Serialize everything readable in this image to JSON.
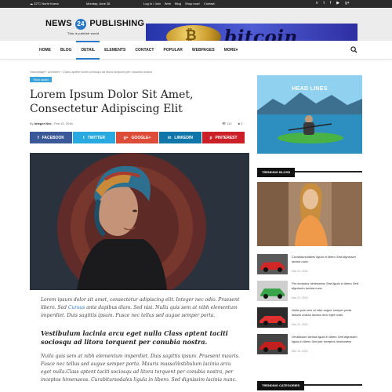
{
  "topbar": {
    "location": "22°C North Korea",
    "date": "Monday, June 28",
    "links": [
      "Log In / Join",
      "Web",
      "Blog",
      "Shop now!",
      "Contact"
    ],
    "social_icons": [
      "vimeo-icon",
      "twitter-icon",
      "facebook-icon",
      "youtube-icon",
      "google-plus-icon"
    ]
  },
  "logo": {
    "left": "NEWS",
    "number": "24",
    "right": "PUBLISHING",
    "tagline": "This is publish world"
  },
  "ad": {
    "word": "bitcoin",
    "coin_symbol": "₿"
  },
  "nav": {
    "items": [
      {
        "label": "HOME"
      },
      {
        "label": "BLOG"
      },
      {
        "label": "DETAIL",
        "active": true
      },
      {
        "label": "ELEMENTS"
      },
      {
        "label": "CONTACT"
      },
      {
        "label": "POPULAR"
      },
      {
        "label": "WEBPAGES"
      },
      {
        "label": "MORE▾"
      }
    ]
  },
  "article": {
    "breadcrumb": "Homepage › Architect › Class aptent taciti sociosqu ad litora torquent per conubia nostra",
    "tag": "Tech world",
    "title": "Lorem Ipsum Dolor Sit Amet, Consectetur Adipiscing Elit",
    "author_prefix": "By",
    "author": "Integer Nec",
    "date": "- Feb 19, 2016",
    "views": "112",
    "comments": "3",
    "share_buttons": [
      {
        "label": "FACEBOOK",
        "icon": "f"
      },
      {
        "label": "TWITTER",
        "icon": "t"
      },
      {
        "label": "GOOGLE+",
        "icon": "g+"
      },
      {
        "label": "LINKEDIN",
        "icon": "in"
      },
      {
        "label": "PINTEREST",
        "icon": "p"
      }
    ],
    "p1_a": "Lorem ipsum dolor sit amet, consectetur adipiscing elit. Integer nec odio. Praesent libero. Sed ",
    "p1_link": "Cursus",
    "p1_b": " ante dapibus diam. Sed nisi. Nulla quis sem at nibh elementum imperdiet. Duis sagittis ipsum. Fusce nec tellus sed augue semper porta.",
    "lead": "Vestibulum lacinia arcu eget nulla Class aptent taciti sociosqu ad litora torquent per conubia nostra.",
    "p2": "Nulla quis sem at nibh elementum imperdiet. Duis sagittis ipsum. Praesent mauris. Fusce nec tellus sed augue semper porta. Mauris massaVestibulum lacinia arcu eget nulla.Class aptent taciti sociosqu ad litora torquent per conubia nostra, per inceptos himenaeos. Curabitursodales ligula in libero. Sed dignissim lacinia nunc."
  },
  "sidebar": {
    "ad_title": "HEAD LINES",
    "trending_title": "TRENDING BLOGS",
    "categories_title": "TRENDING CATEGORIES",
    "trending": [
      {
        "title": "Curabitursodales ligula in libero Sed dignissim lacinia nunc.",
        "date": "Mar 10, 2016"
      },
      {
        "title": "Per inceptos himenaeos Sed ligula in libero Sed dignissim lacinia nunc.",
        "date": "Mar 10, 2016"
      },
      {
        "title": "Nulla quis sem at nibh augue semper porta Mauris massa lacinia arcu eget nulla.",
        "date": "Mar 10, 2016"
      },
      {
        "title": "Vestibulum lacinia ligula in libero Sed dignissim ligula in libero Sed per inceptos himenaeos",
        "date": "Mar 10, 2016"
      }
    ]
  },
  "colors": {
    "accent": "#2c79c7",
    "topbar": "#2b2b2b",
    "header_bg": "#ececec"
  }
}
